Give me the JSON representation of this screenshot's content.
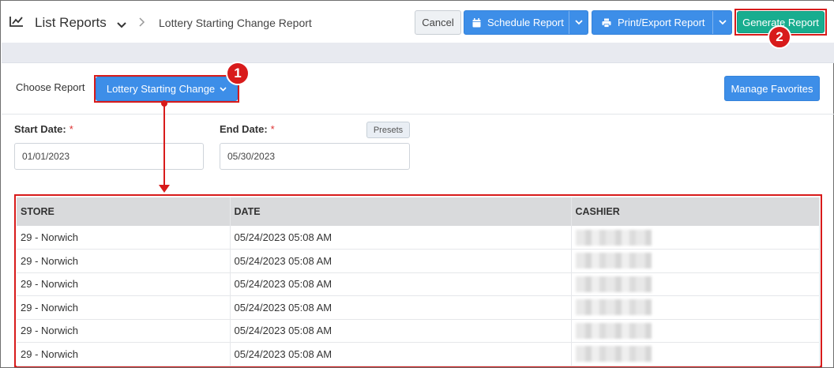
{
  "header": {
    "title": "List Reports",
    "breadcrumb": "Lottery Starting Change Report",
    "cancel_label": "Cancel",
    "schedule_label": "Schedule Report",
    "print_label": "Print/Export Report",
    "generate_label": "Generate Report"
  },
  "report_picker": {
    "label": "Choose Report",
    "selected": "Lottery Starting Change",
    "manage_favorites_label": "Manage Favorites"
  },
  "filters": {
    "start_label": "Start Date:",
    "start_value": "01/01/2023",
    "end_label": "End Date:",
    "end_value": "05/30/2023",
    "required_mark": "*",
    "presets_label": "Presets"
  },
  "table": {
    "columns": [
      "STORE",
      "DATE",
      "CASHIER"
    ],
    "rows": [
      {
        "store": "29 - Norwich",
        "date": "05/24/2023 05:08 AM"
      },
      {
        "store": "29 - Norwich",
        "date": "05/24/2023 05:08 AM"
      },
      {
        "store": "29 - Norwich",
        "date": "05/24/2023 05:08 AM"
      },
      {
        "store": "29 - Norwich",
        "date": "05/24/2023 05:08 AM"
      },
      {
        "store": "29 - Norwich",
        "date": "05/24/2023 05:08 AM"
      },
      {
        "store": "29 - Norwich",
        "date": "05/24/2023 05:08 AM"
      }
    ]
  },
  "annotations": {
    "step1": "1",
    "step2": "2",
    "highlight_color": "#d81b1b"
  },
  "colors": {
    "primary": "#3d8ee8",
    "generate": "#18ad8f"
  }
}
